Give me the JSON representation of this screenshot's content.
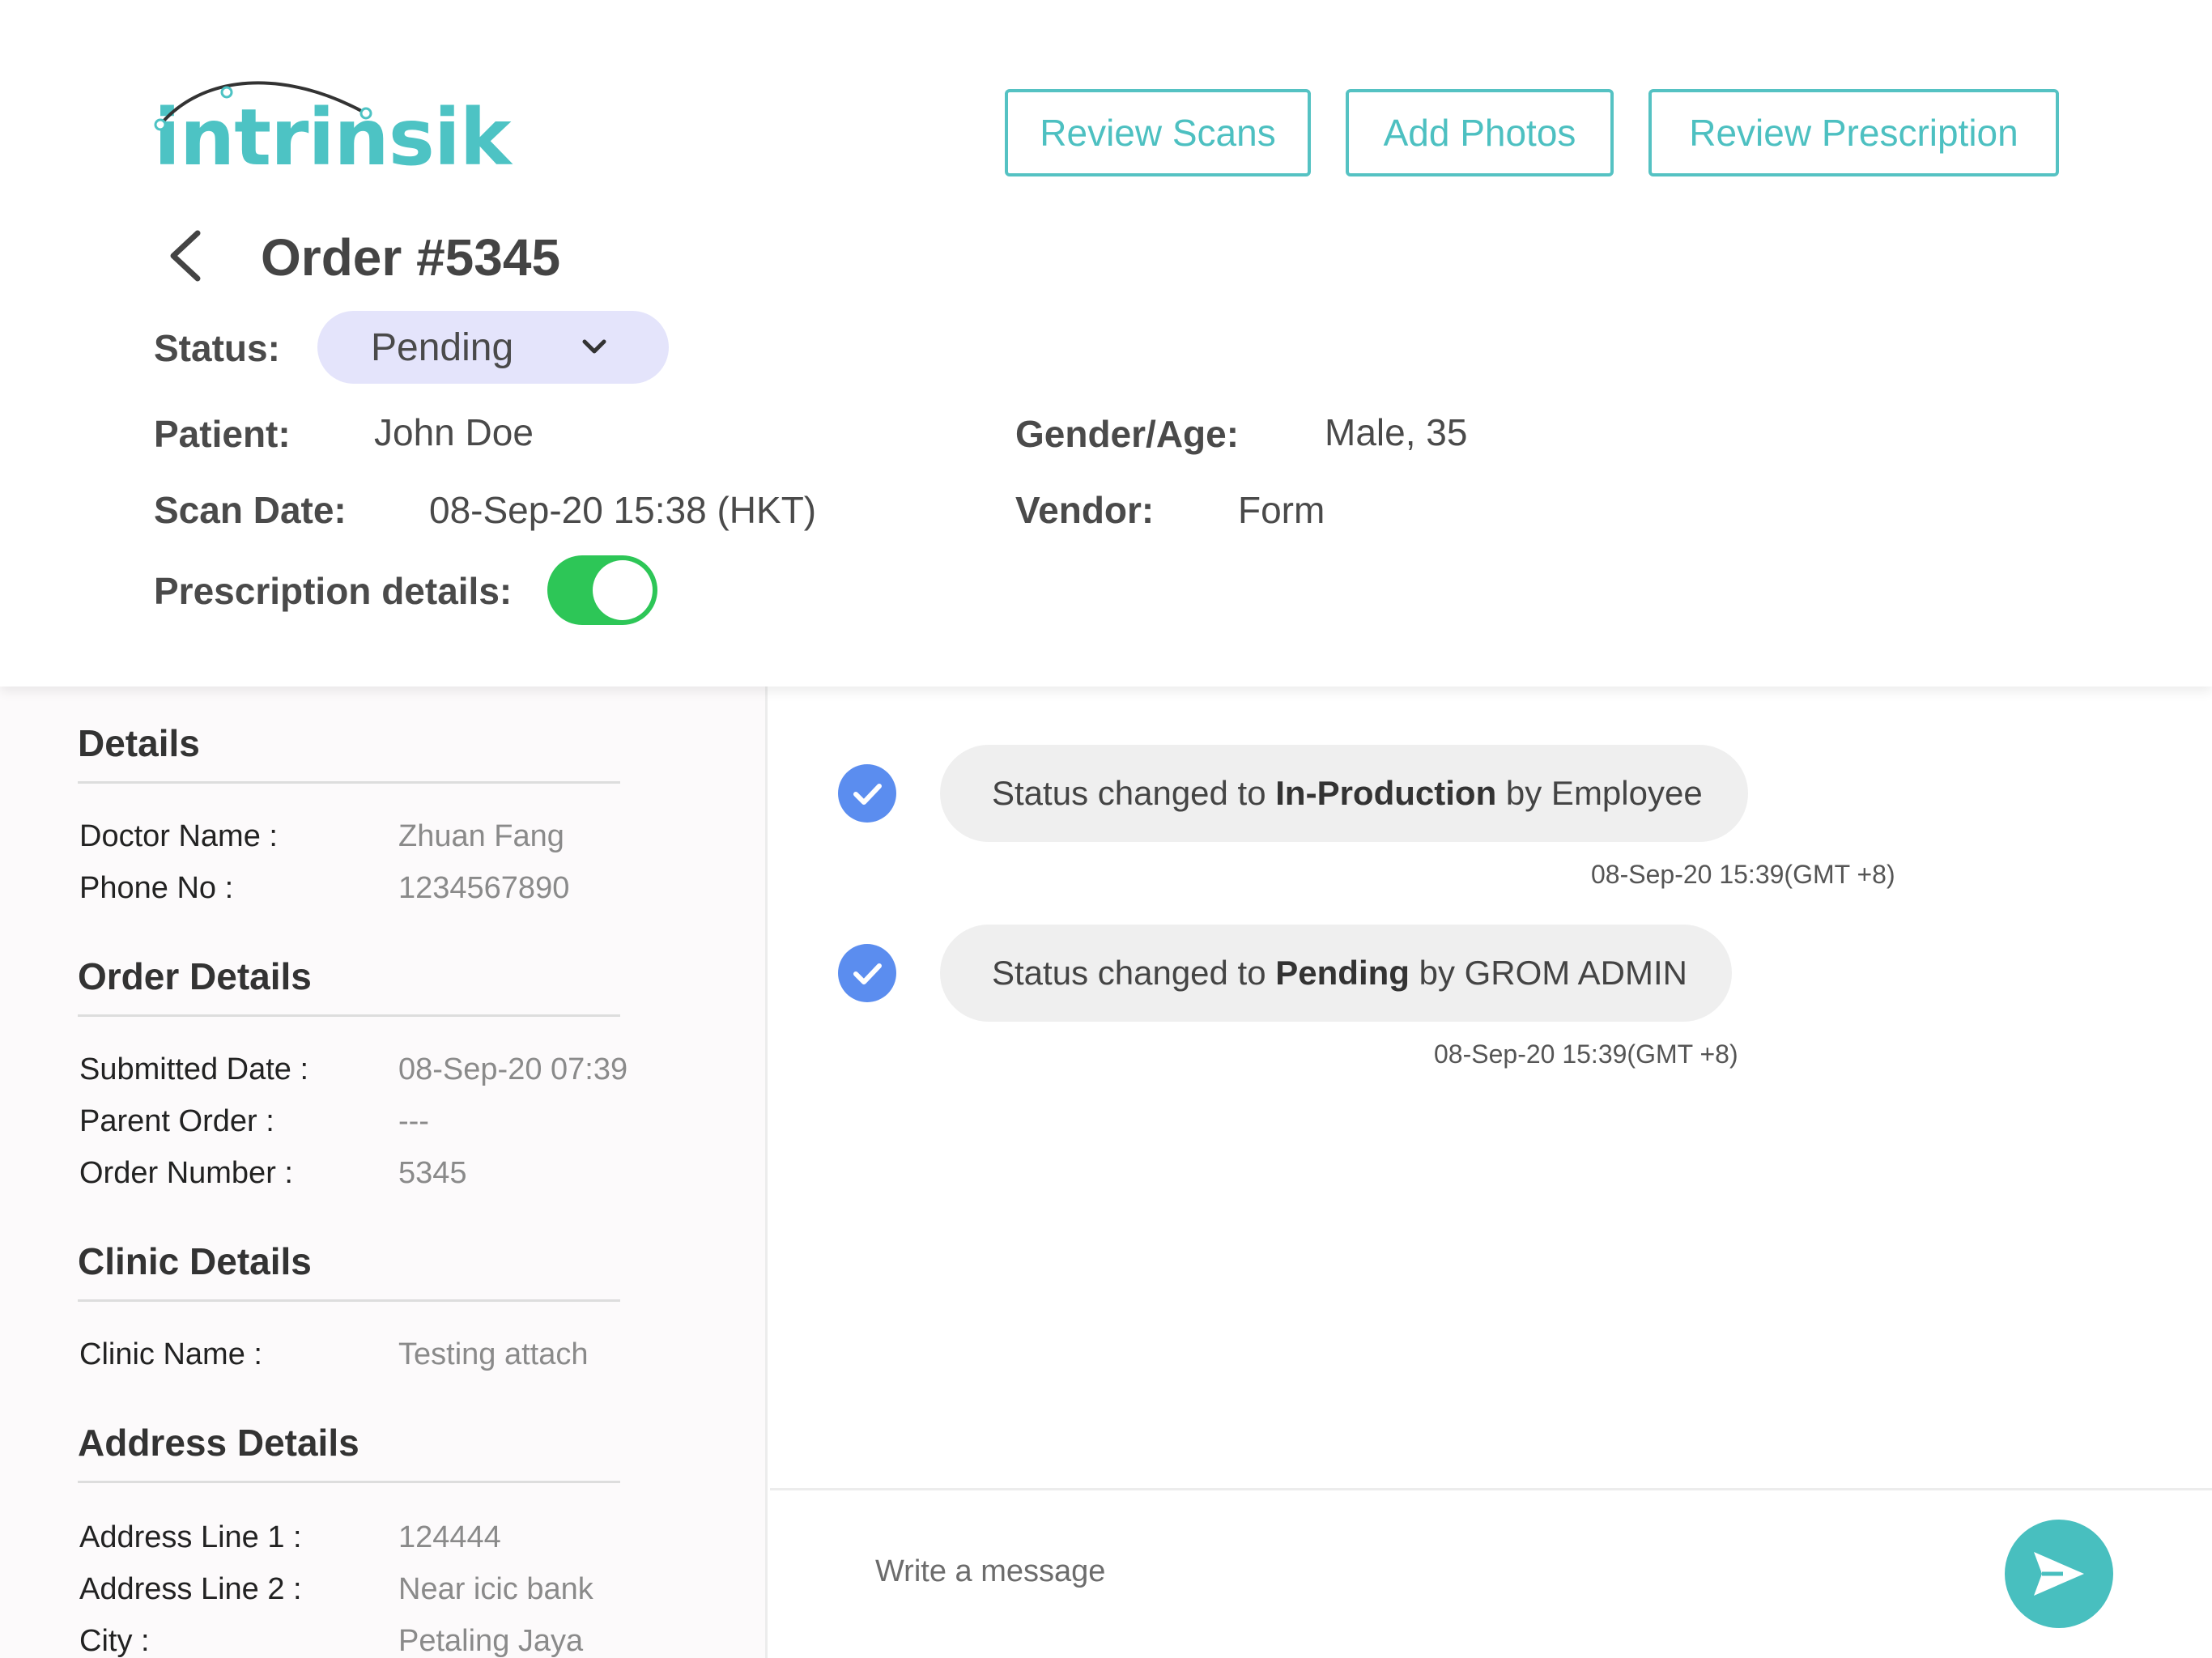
{
  "brand": {
    "logo_text": "intrinsik",
    "accent": "#4dc3c4"
  },
  "toolbar": {
    "review_scans": "Review Scans",
    "add_photos": "Add Photos",
    "review_prescription": "Review Prescription"
  },
  "order": {
    "title": "Order #5345",
    "status_label": "Status:",
    "status_value": "Pending",
    "patient_label": "Patient:",
    "patient_value": "John Doe",
    "gender_age_label": "Gender/Age:",
    "gender_age_value": "Male, 35",
    "scan_date_label": "Scan Date:",
    "scan_date_value": "08-Sep-20 15:38 (HKT)",
    "vendor_label": "Vendor:",
    "vendor_value": "Form",
    "prescription_label": "Prescription details:",
    "prescription_on": true
  },
  "details": {
    "title": "Details",
    "doctor_label": "Doctor Name :",
    "doctor_value": "Zhuan Fang",
    "phone_label": "Phone No :",
    "phone_value": "1234567890"
  },
  "order_details": {
    "title": "Order Details",
    "submitted_label": "Submitted Date :",
    "submitted_value": "08-Sep-20 07:39",
    "parent_label": "Parent Order :",
    "parent_value": "---",
    "number_label": "Order Number :",
    "number_value": "5345"
  },
  "clinic_details": {
    "title": "Clinic Details",
    "name_label": "Clinic Name :",
    "name_value": "Testing attach"
  },
  "address_details": {
    "title": "Address Details",
    "line1_label": "Address Line 1 :",
    "line1_value": "124444",
    "line2_label": "Address Line 2 :",
    "line2_value": "Near icic bank",
    "city_label": "City :",
    "city_value": "Petaling Jaya"
  },
  "timeline": [
    {
      "prefix": "Status changed to ",
      "status": "In-Production",
      "suffix": " by Employee",
      "timestamp": "08-Sep-20 15:39(GMT +8)"
    },
    {
      "prefix": "Status changed to ",
      "status": "Pending",
      "suffix": " by GROM ADMIN",
      "timestamp": "08-Sep-20 15:39(GMT +8)"
    }
  ],
  "composer": {
    "placeholder": "Write a message"
  },
  "colors": {
    "teal": "#4dc3c4",
    "status_pill": "#e4e4fb",
    "toggle_on": "#2dc657",
    "check_blue": "#5b8def"
  }
}
